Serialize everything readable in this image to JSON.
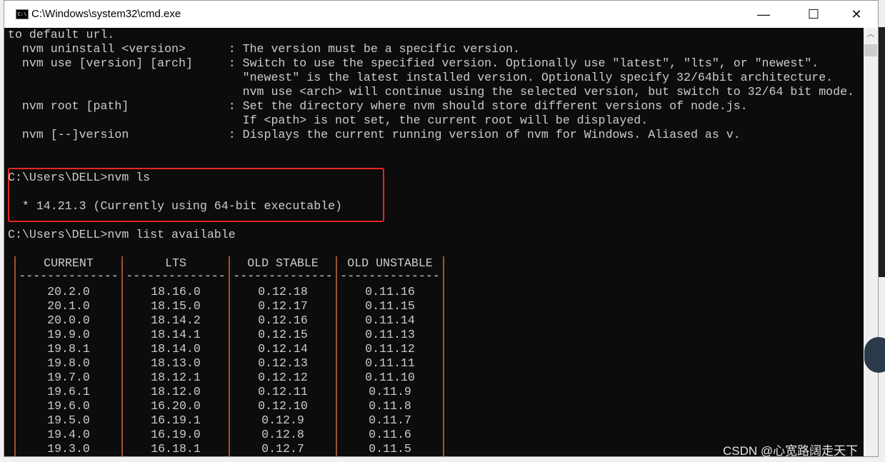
{
  "window": {
    "title": "C:\\Windows\\system32\\cmd.exe",
    "icon": "cmd-icon",
    "controls": [
      "minimize-icon",
      "maximize-icon",
      "close-icon"
    ]
  },
  "terminal": {
    "lines": [
      "to default url.",
      "  nvm uninstall <version>      : The version must be a specific version.",
      "  nvm use [version] [arch]     : Switch to use the specified version. Optionally use \"latest\", \"lts\", or \"newest\".",
      "                                 \"newest\" is the latest installed version. Optionally specify 32/64bit architecture.",
      "                                 nvm use <arch> will continue using the selected version, but switch to 32/64 bit mode.",
      "  nvm root [path]              : Set the directory where nvm should store different versions of node.js.",
      "                                 If <path> is not set, the current root will be displayed.",
      "  nvm [--]version              : Displays the current running version of nvm for Windows. Aliased as v.",
      "",
      "",
      "C:\\Users\\DELL>nvm ls",
      "",
      "  * 14.21.3 (Currently using 64-bit executable)",
      "",
      "C:\\Users\\DELL>nvm list available",
      ""
    ]
  },
  "table": {
    "headers": [
      "CURRENT",
      "LTS",
      "OLD STABLE",
      "OLD UNSTABLE"
    ],
    "separator": "--------------",
    "rows": [
      [
        "20.2.0",
        "18.16.0",
        "0.12.18",
        "0.11.16"
      ],
      [
        "20.1.0",
        "18.15.0",
        "0.12.17",
        "0.11.15"
      ],
      [
        "20.0.0",
        "18.14.2",
        "0.12.16",
        "0.11.14"
      ],
      [
        "19.9.0",
        "18.14.1",
        "0.12.15",
        "0.11.13"
      ],
      [
        "19.8.1",
        "18.14.0",
        "0.12.14",
        "0.11.12"
      ],
      [
        "19.8.0",
        "18.13.0",
        "0.12.13",
        "0.11.11"
      ],
      [
        "19.7.0",
        "18.12.1",
        "0.12.12",
        "0.11.10"
      ],
      [
        "19.6.1",
        "18.12.0",
        "0.12.11",
        "0.11.9"
      ],
      [
        "19.6.0",
        "16.20.0",
        "0.12.10",
        "0.11.8"
      ],
      [
        "19.5.0",
        "16.19.1",
        "0.12.9",
        "0.11.7"
      ],
      [
        "19.4.0",
        "16.19.0",
        "0.12.8",
        "0.11.6"
      ],
      [
        "19.3.0",
        "16.18.1",
        "0.12.7",
        "0.11.5"
      ]
    ]
  },
  "highlight_color": "#e8261f",
  "watermark": "CSDN @心宽路阔走天下"
}
